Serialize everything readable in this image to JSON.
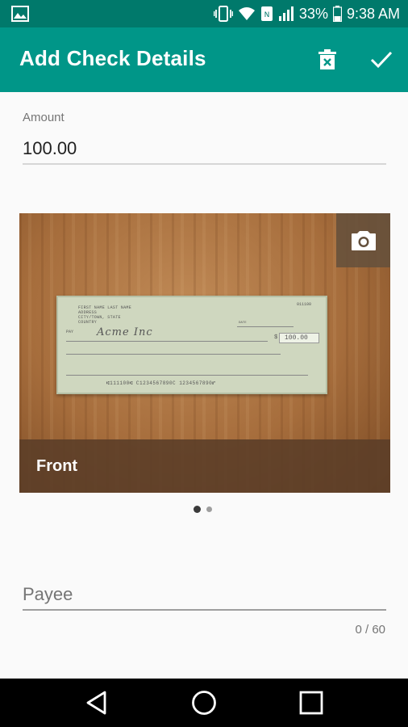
{
  "status_bar": {
    "battery": "33%",
    "time": "9:38 AM",
    "icons": [
      "gallery-icon",
      "vibrate-icon",
      "wifi-icon",
      "nfc-icon",
      "signal-icon",
      "battery-icon"
    ]
  },
  "app_bar": {
    "title": "Add Check Details",
    "actions": [
      "delete-icon",
      "check-icon"
    ]
  },
  "form": {
    "amount_label": "Amount",
    "amount_value": "100.00",
    "payee_placeholder": "Payee",
    "payee_value": "",
    "payee_counter": "0 / 60"
  },
  "photo": {
    "side_label": "Front",
    "pages": 2,
    "current_page": 1,
    "check": {
      "owner_line1": "FIRST NAME LAST NAME",
      "owner_line2": "ADDRESS",
      "owner_line3": "CITY/TOWN, STATE",
      "owner_line4": "COUNTRY",
      "check_number": "011100",
      "date_label": "DATE",
      "pay_to_label": "PAY",
      "handwritten_payee": "Acme Inc",
      "amount_box": "100.00",
      "micr": "⑆111100⑆ C1234567890C 1234567890⑈"
    }
  },
  "colors": {
    "status_bar": "#00796b",
    "app_bar": "#009688",
    "background": "#fafafa"
  },
  "nav": {
    "buttons": [
      "back-icon",
      "home-icon",
      "recents-icon"
    ]
  }
}
